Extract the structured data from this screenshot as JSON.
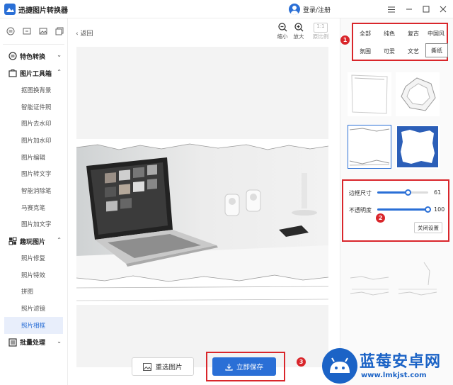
{
  "app": {
    "title": "迅捷图片转换器",
    "login": "登录/注册"
  },
  "window_controls": [
    "menu-icon",
    "minimize-icon",
    "maximize-icon",
    "close-icon"
  ],
  "sidebar": {
    "top_icons": [
      "convert-icon",
      "crop-icon",
      "image-icon",
      "layers-icon"
    ],
    "groups": [
      {
        "label": "特色转换",
        "expanded": false,
        "items": []
      },
      {
        "label": "图片工具箱",
        "expanded": true,
        "items": [
          "抠图换背景",
          "智能证件照",
          "图片去水印",
          "图片加水印",
          "图片编辑",
          "图片转文字",
          "智能消除笔",
          "马赛克笔",
          "图片加文字"
        ]
      },
      {
        "label": "趣玩图片",
        "expanded": true,
        "items": [
          "照片修复",
          "照片特效",
          "拼图",
          "照片滤镜",
          "照片相框"
        ]
      },
      {
        "label": "批量处理",
        "expanded": false,
        "items": []
      }
    ],
    "active_item": "照片相框"
  },
  "main": {
    "back_label": "返回",
    "zoom_out": "缩小",
    "zoom_in": "放大",
    "ratio_badge": "1:1",
    "original_ratio": "原比例",
    "reselect_label": "重选图片",
    "save_label": "立即保存",
    "marker_save": "3"
  },
  "frames_panel": {
    "tabs_row1": [
      "全部",
      "纯色",
      "复古",
      "中国风"
    ],
    "tabs_row2": [
      "氛围",
      "可爱",
      "文艺",
      "撕纸"
    ],
    "active_tab": "撕纸",
    "marker_tabs": "1",
    "settings": {
      "border_size_label": "边框尺寸",
      "border_size_value": "61",
      "border_size_fraction": 0.61,
      "opacity_label": "不透明度",
      "opacity_value": "100",
      "opacity_fraction": 1.0,
      "close_label": "关闭设置",
      "marker": "2"
    }
  },
  "watermark": {
    "title": "蓝莓安卓网",
    "url": "www.lmkjst.com"
  },
  "colors": {
    "accent": "#2a6fd6",
    "highlight": "#d9262b"
  }
}
